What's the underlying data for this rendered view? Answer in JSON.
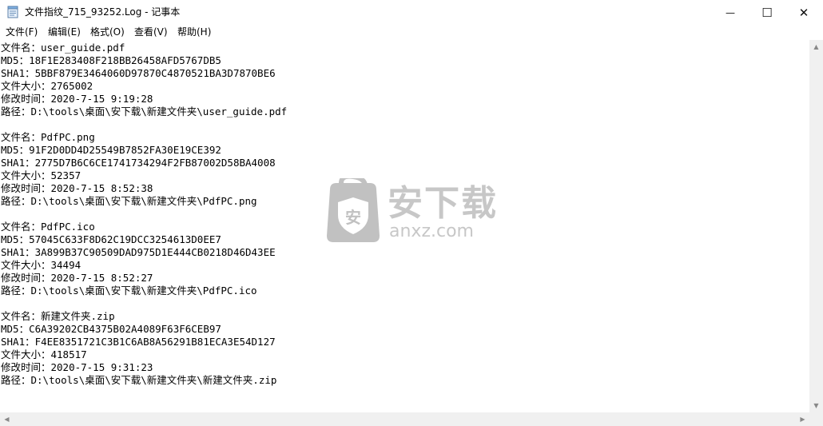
{
  "window": {
    "title": "文件指纹_715_93252.Log - 记事本",
    "minimize_glyph": "—",
    "maximize_glyph": "☐",
    "close_glyph": "✕"
  },
  "menu": [
    {
      "label": "文件(F)"
    },
    {
      "label": "编辑(E)"
    },
    {
      "label": "格式(O)"
    },
    {
      "label": "查看(V)"
    },
    {
      "label": "帮助(H)"
    }
  ],
  "content": {
    "lines": [
      "文件名：user_guide.pdf",
      "MD5：18F1E283408F218BB26458AFD5767DB5",
      "SHA1：5BBF879E3464060D97870C4870521BA3D7870BE6",
      "文件大小：2765002",
      "修改时间：2020-7-15 9:19:28",
      "路径：D:\\tools\\桌面\\安下载\\新建文件夹\\user_guide.pdf",
      "",
      "文件名：PdfPC.png",
      "MD5：91F2D0DD4D25549B7852FA30E19CE392",
      "SHA1：2775D7B6C6CE1741734294F2FB87002D58BA4008",
      "文件大小：52357",
      "修改时间：2020-7-15 8:52:38",
      "路径：D:\\tools\\桌面\\安下载\\新建文件夹\\PdfPC.png",
      "",
      "文件名：PdfPC.ico",
      "MD5：57045C633F8D62C19DCC3254613D0EE7",
      "SHA1：3A899B37C90509DAD975D1E444CB0218D46D43EE",
      "文件大小：34494",
      "修改时间：2020-7-15 8:52:27",
      "路径：D:\\tools\\桌面\\安下载\\新建文件夹\\PdfPC.ico",
      "",
      "文件名：新建文件夹.zip",
      "MD5：C6A39202CB4375B02A4089F63F6CEB97",
      "SHA1：F4EE8351721C3B1C6AB8A56291B81ECA3E54D127",
      "文件大小：418517",
      "修改时间：2020-7-15 9:31:23",
      "路径：D:\\tools\\桌面\\安下载\\新建文件夹\\新建文件夹.zip"
    ]
  },
  "watermark": {
    "main": "安下载",
    "sub": "anxz.com",
    "badge": "安"
  },
  "scrollbar": {
    "up_glyph": "▲",
    "down_glyph": "▼",
    "left_glyph": "◀",
    "right_glyph": "▶"
  },
  "colors": {
    "background": "#ffffff",
    "scrollbar": "#f0f0f0",
    "watermark": "#9a9a9a"
  }
}
